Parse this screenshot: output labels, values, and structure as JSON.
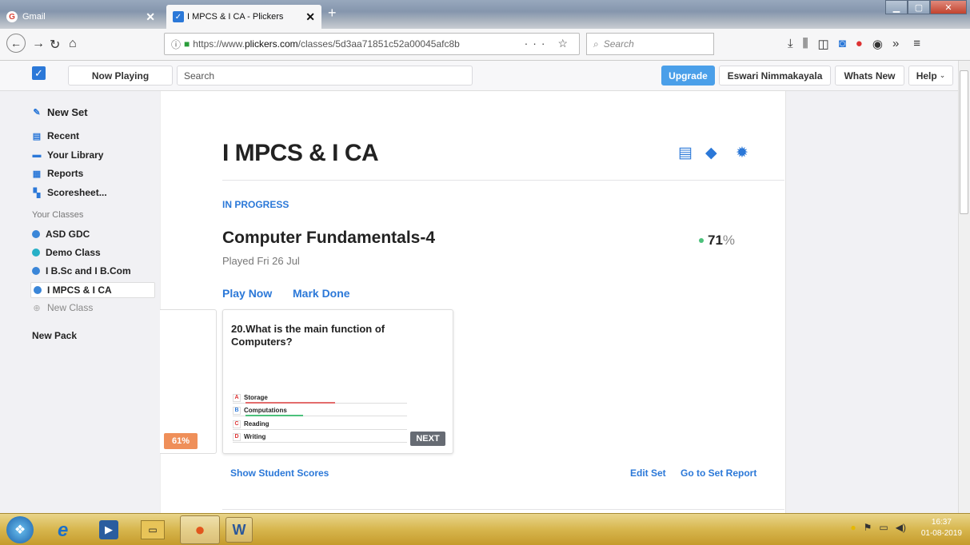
{
  "browser": {
    "tabs": [
      {
        "label": "Gmail",
        "close": "✕"
      },
      {
        "label": "I MPCS & I CA - Plickers",
        "close": "✕"
      }
    ],
    "new_tab": "+",
    "url_prefix": "https://www.",
    "url_host": "plickers.com",
    "url_path": "/classes/5d3aa71851c52a00045afc8b",
    "url_actions": "··· ☆",
    "search_placeholder": "Search"
  },
  "header": {
    "now_playing": "Now Playing",
    "search_placeholder": "Search",
    "upgrade": "Upgrade",
    "user": "Eswari Nimmakayala",
    "whats_new": "Whats New",
    "help": "Help"
  },
  "sidebar": {
    "new_set": "New Set",
    "recent": "Recent",
    "library": "Your Library",
    "reports": "Reports",
    "scoresheet": "Scoresheet...",
    "classes_heading": "Your Classes",
    "classes": [
      {
        "name": "ASD GDC",
        "color": "#3a86d8"
      },
      {
        "name": "Demo Class",
        "color": "#27b0c7"
      },
      {
        "name": "I B.Sc and I B.Com",
        "color": "#3a86d8"
      },
      {
        "name": "I MPCS & I CA",
        "color": "#3a86d8"
      }
    ],
    "new_class": "New Class",
    "new_pack": "New Pack"
  },
  "main": {
    "class_title": "I MPCS & I CA",
    "status": "IN PROGRESS",
    "set_title": "Computer Fundamentals-4",
    "score": "71",
    "score_unit": "%",
    "played": "Played Fri 26 Jul",
    "play_now": "Play Now",
    "mark_done": "Mark Done",
    "question": "20.What is the main function of Computers?",
    "options": [
      {
        "letter": "A",
        "text": "Storage",
        "bar_pct": 56,
        "bar_color": "#e36c6c"
      },
      {
        "letter": "B",
        "text": "Computations",
        "bar_pct": 36,
        "bar_color": "#4cc17b"
      },
      {
        "letter": "C",
        "text": "Reading",
        "bar_pct": 0,
        "bar_color": "#e36c6c"
      },
      {
        "letter": "D",
        "text": "Writing",
        "bar_pct": 0,
        "bar_color": "#e36c6c"
      }
    ],
    "next": "NEXT",
    "prev_pct": "61%",
    "show_scores": "Show Student Scores",
    "edit_set": "Edit Set",
    "set_report": "Go to Set Report"
  },
  "taskbar": {
    "time": "16:37",
    "date": "01-08-2019"
  },
  "colors": {
    "accent": "#2b78d8",
    "success": "#4cc17b",
    "warning": "#ef8f59"
  }
}
